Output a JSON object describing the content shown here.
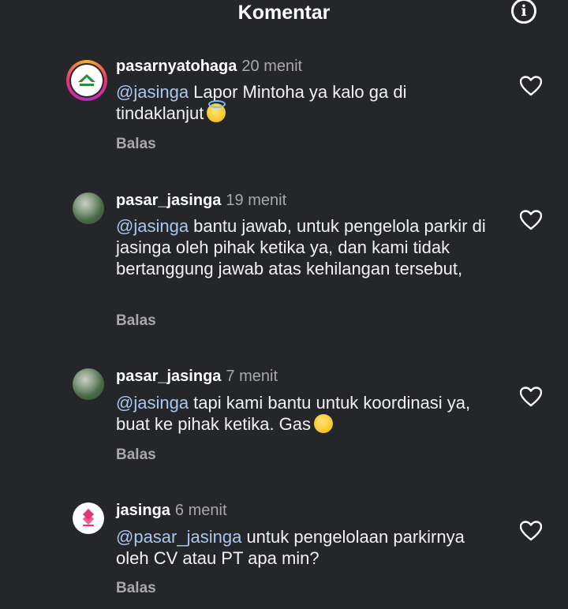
{
  "header": {
    "title": "Komentar",
    "info_icon": "info-icon"
  },
  "comments": [
    {
      "username": "pasarnyatohaga",
      "time": "20 menit",
      "mention": "@jasinga",
      "text": " Lapor Mintoha ya kalo ga di tindaklanjut",
      "emoji": "smiling-face-with-halo",
      "reply_label": "Balas",
      "avatar": "store-logo-avatar",
      "has_story_ring": true
    },
    {
      "username": "pasar_jasinga",
      "time": "19 menit",
      "mention": "@jasinga",
      "text": " bantu jawab, untuk pengelola parkir di jasinga oleh pihak ketika ya, dan kami tidak bertanggung jawab atas kehilangan tersebut,",
      "reply_label": "Balas",
      "avatar": "market-photo-avatar",
      "has_story_ring": false
    },
    {
      "username": "pasar_jasinga",
      "time": "7 menit",
      "mention": "@jasinga",
      "text": " tapi kami bantu untuk koordinasi ya, buat ke pihak ketika. Gas",
      "emoji": "smiling-face",
      "reply_label": "Balas",
      "avatar": "market-photo-avatar",
      "has_story_ring": false
    },
    {
      "username": "jasinga",
      "time": "6 menit",
      "mention": "@pasar_jasinga",
      "text": " untuk pengelolaan parkirnya oleh CV atau PT apa min?",
      "reply_label": "Balas",
      "avatar": "jasinga-logo-avatar",
      "has_story_ring": false
    }
  ],
  "like_icon": "heart-outline-icon",
  "colors": {
    "background": "#25262a",
    "mention": "#a9c8ee",
    "secondary_text": "#a8a8ad"
  }
}
